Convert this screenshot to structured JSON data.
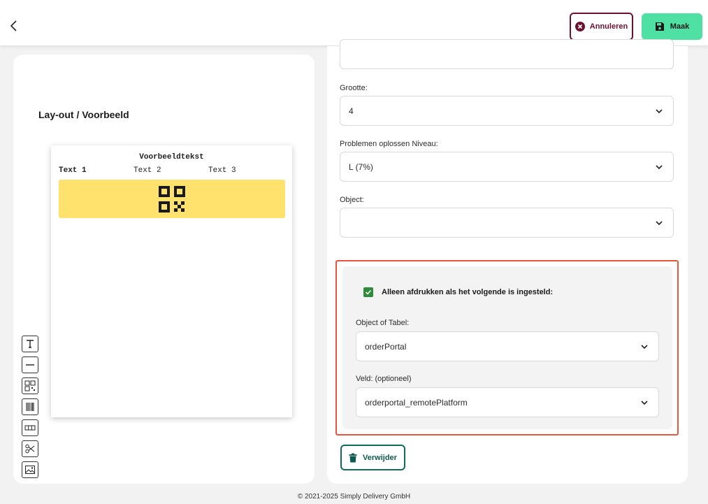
{
  "header": {
    "back_icon": "chevron-left-icon",
    "cancel_label": "Annuleren",
    "save_label": "Maak",
    "colors": {
      "cancel": "#6b1030",
      "save_bg": "#4fe0a3"
    }
  },
  "preview": {
    "title": "Lay-out / Voorbeeld",
    "heading": "Voorbeeldtekst",
    "texts": [
      "Text 1",
      "Text 2",
      "Text 3"
    ],
    "accent": "#ffe16e",
    "qr_icon": "qr-code-icon"
  },
  "tools": [
    {
      "name": "text-tool",
      "icon": "text-icon"
    },
    {
      "name": "line-tool",
      "icon": "line-icon"
    },
    {
      "name": "qr-tool",
      "icon": "qr-code-icon"
    },
    {
      "name": "barcode-tool",
      "icon": "barcode-icon"
    },
    {
      "name": "table-tool",
      "icon": "table-icon"
    },
    {
      "name": "cut-tool",
      "icon": "scissors-icon"
    },
    {
      "name": "image-tool",
      "icon": "image-icon"
    }
  ],
  "form": {
    "top_field": {
      "value": ""
    },
    "size": {
      "label": "Grootte:",
      "value": "4"
    },
    "error_level": {
      "label": "Problemen oplossen Niveau:",
      "value": "L (7%)"
    },
    "object": {
      "label": "Object:",
      "value": ""
    },
    "condition": {
      "checkbox_label": "Alleen afdrukken als het volgende is ingesteld:",
      "checked": true,
      "object_label": "Object of Tabel:",
      "object_value": "orderPortal",
      "field_label": "Veld: (optioneel)",
      "field_value": "orderportal_remotePlatform",
      "highlight_color": "#e8553a"
    },
    "delete_label": "Verwijder"
  },
  "footer": {
    "text": "© 2021-2025 Simply Delivery GmbH"
  }
}
